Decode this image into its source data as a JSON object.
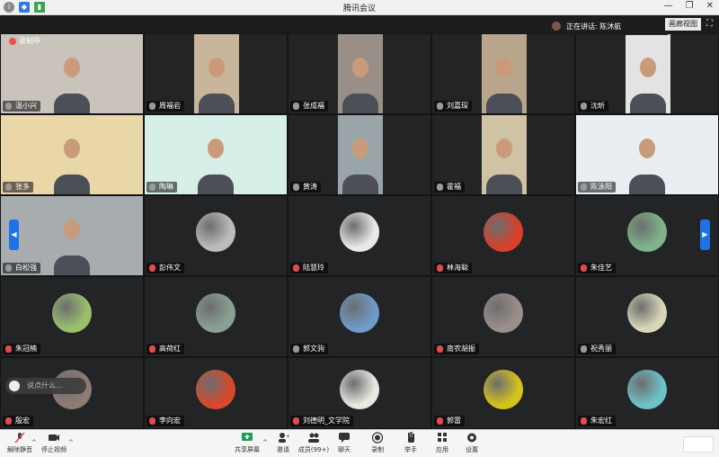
{
  "window": {
    "title": "腾讯会议"
  },
  "banner": {
    "speaking_label": "正在讲话: 陈沐航",
    "view_label": "画廊视图"
  },
  "overlay": {
    "top_left_label": "录制中",
    "chat_placeholder": "说点什么..."
  },
  "participants": [
    {
      "name": "温小兴",
      "type": "video",
      "bg": "#c9c3bc",
      "muted": false
    },
    {
      "name": "周福岩",
      "type": "video",
      "bg": "#c8b59c",
      "muted": false
    },
    {
      "name": "张成福",
      "type": "video",
      "bg": "#9a8f86",
      "muted": false
    },
    {
      "name": "刘嘉琛",
      "type": "video",
      "bg": "#b9a58c",
      "muted": false
    },
    {
      "name": "沈昕",
      "type": "video",
      "bg": "#e3e3e3",
      "muted": false
    },
    {
      "name": "张多",
      "type": "video",
      "bg": "#ead7a8",
      "muted": false
    },
    {
      "name": "陶琳",
      "type": "video",
      "bg": "#d6efe8",
      "muted": false
    },
    {
      "name": "黄涛",
      "type": "video",
      "bg": "#9aa5aa",
      "muted": false
    },
    {
      "name": "霍福",
      "type": "video",
      "bg": "#cfc3a4",
      "muted": false
    },
    {
      "name": "陈泳阳",
      "type": "video",
      "bg": "#e8eef2",
      "muted": false
    },
    {
      "name": "白松强",
      "type": "video",
      "bg": "#a7acaf",
      "muted": false
    },
    {
      "name": "彭伟文",
      "type": "avatar",
      "bg": "#bcbcbc",
      "muted": true
    },
    {
      "name": "陆慧玲",
      "type": "avatar",
      "bg": "#e9e9e9",
      "muted": true
    },
    {
      "name": "林海聪",
      "type": "avatar",
      "bg": "#d8402c",
      "muted": true
    },
    {
      "name": "朱佳艺",
      "type": "avatar",
      "bg": "#7fb48a",
      "muted": true
    },
    {
      "name": "朱冠楠",
      "type": "avatar",
      "bg": "#9bbf6e",
      "muted": true
    },
    {
      "name": "高荷红",
      "type": "avatar",
      "bg": "#8aa092",
      "muted": true
    },
    {
      "name": "郭文驹",
      "type": "avatar",
      "bg": "#6e9bc8",
      "muted": false
    },
    {
      "name": "南农胡振",
      "type": "avatar",
      "bg": "#9b8f8a",
      "muted": true
    },
    {
      "name": "祝秀丽",
      "type": "avatar",
      "bg": "#d9d6b8",
      "muted": false
    },
    {
      "name": "殷宏",
      "type": "avatar",
      "bg": "#8e7b73",
      "muted": true
    },
    {
      "name": "李向宏",
      "type": "avatar",
      "bg": "#d8482c",
      "muted": true
    },
    {
      "name": "刘德明_文学院",
      "type": "avatar",
      "bg": "#e9e9e2",
      "muted": true
    },
    {
      "name": "郭雷",
      "type": "avatar",
      "bg": "#d6c21c",
      "muted": true
    },
    {
      "name": "朱宏红",
      "type": "avatar",
      "bg": "#6ec1c9",
      "muted": true
    }
  ],
  "toolbar": {
    "unmute": "解除静音",
    "stop_video": "停止视频",
    "share_screen": "共享屏幕",
    "invite": "邀请",
    "members": "成员(99+)",
    "chat": "聊天",
    "record": "录制",
    "raise_hand": "举手",
    "apps": "应用",
    "settings": "设置"
  },
  "colors": {
    "accent": "#1e72e8",
    "muted": "#e04b4b",
    "share_green": "#18a058"
  }
}
